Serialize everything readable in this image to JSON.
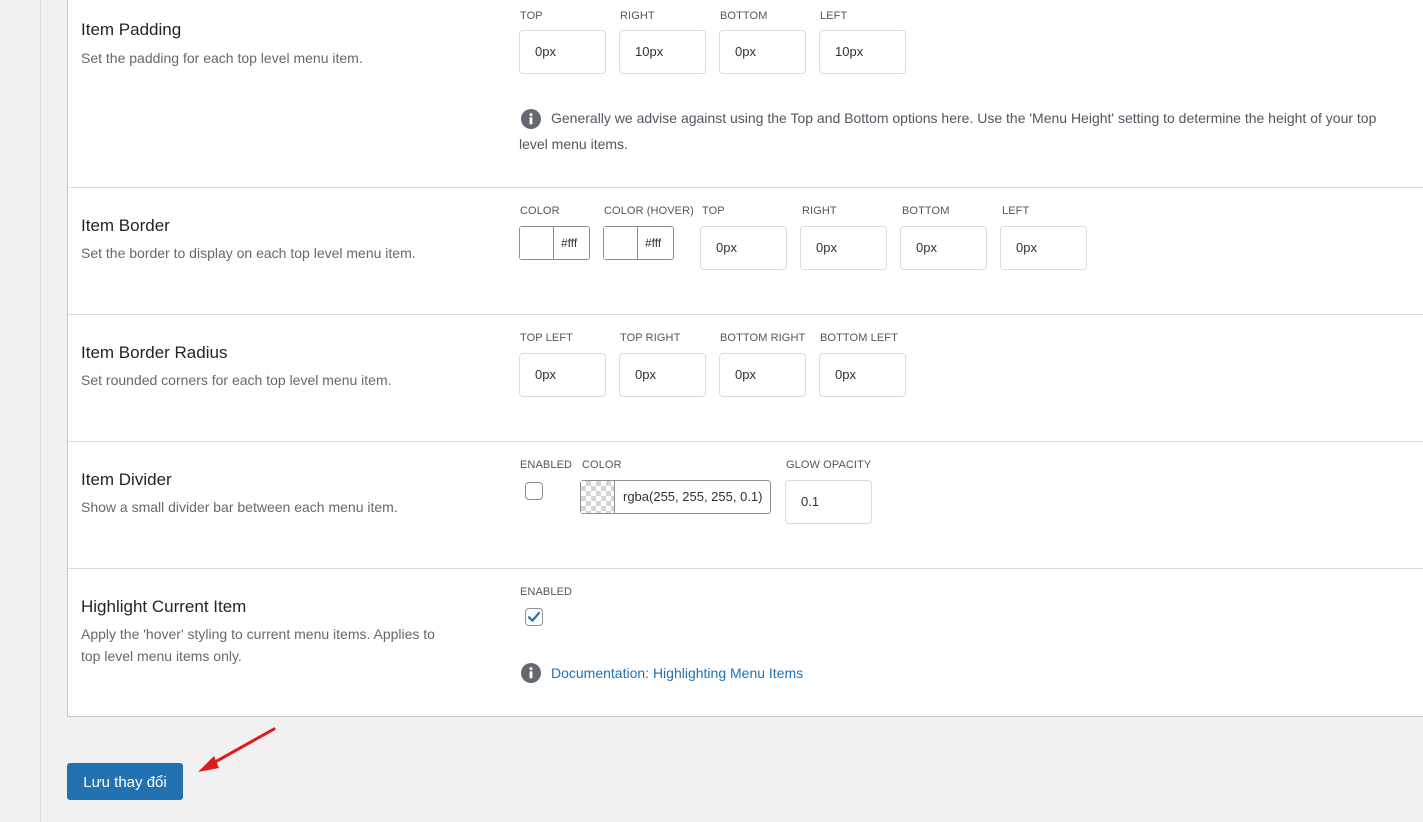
{
  "rows": {
    "padding": {
      "title": "Item Padding",
      "description": "Set the padding for each top level menu item.",
      "fields": [
        {
          "label": "TOP",
          "value": "0px"
        },
        {
          "label": "RIGHT",
          "value": "10px"
        },
        {
          "label": "BOTTOM",
          "value": "0px"
        },
        {
          "label": "LEFT",
          "value": "10px"
        }
      ],
      "note_line1": "Generally we advise against using the Top and Bottom options here. Use the 'Menu Height' setting to determine the height of your top",
      "note_line2": "level menu items."
    },
    "border": {
      "title": "Item Border",
      "description": "Set the border to display on each top level menu item.",
      "color": {
        "label": "COLOR",
        "value": "#fff"
      },
      "color_hover": {
        "label": "COLOR (HOVER)",
        "value": "#fff"
      },
      "fields": [
        {
          "label": "TOP",
          "value": "0px"
        },
        {
          "label": "RIGHT",
          "value": "0px"
        },
        {
          "label": "BOTTOM",
          "value": "0px"
        },
        {
          "label": "LEFT",
          "value": "0px"
        }
      ]
    },
    "radius": {
      "title": "Item Border Radius",
      "description": "Set rounded corners for each top level menu item.",
      "fields": [
        {
          "label": "TOP LEFT",
          "value": "0px"
        },
        {
          "label": "TOP RIGHT",
          "value": "0px"
        },
        {
          "label": "BOTTOM RIGHT",
          "value": "0px"
        },
        {
          "label": "BOTTOM LEFT",
          "value": "0px"
        }
      ]
    },
    "divider": {
      "title": "Item Divider",
      "description": "Show a small divider bar between each menu item.",
      "enabled_label": "ENABLED",
      "enabled": false,
      "color": {
        "label": "COLOR",
        "value": "rgba(255, 255, 255, 0.1)"
      },
      "glow": {
        "label": "GLOW OPACITY",
        "value": "0.1"
      }
    },
    "highlight": {
      "title": "Highlight Current Item",
      "description_line1": "Apply the 'hover' styling to current menu items. Applies to",
      "description_line2": "top level menu items only.",
      "enabled_label": "ENABLED",
      "enabled": true,
      "doc_link": "Documentation: Highlighting Menu Items"
    }
  },
  "save_button": "Lưu thay đổi",
  "icons": {
    "info": "info-icon",
    "check": "checkmark-icon",
    "arrow": "red-arrow-annotation"
  },
  "colors": {
    "accent": "#2271b1",
    "annotation": "#e0191b"
  }
}
